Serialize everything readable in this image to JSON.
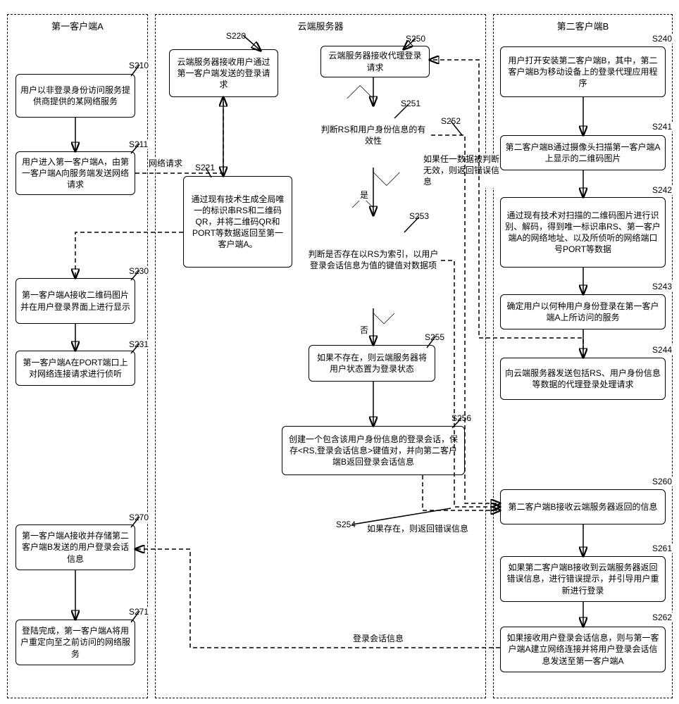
{
  "lanes": {
    "a_title": "第一客户端A",
    "s_title": "云端服务器",
    "b_title": "第二客户端B"
  },
  "steps": {
    "s210": "用户以非登录身份访问服务提供商提供的某网络服务",
    "s211": "用户进入第一客户端A，由第一客户端A向服务端发送网络请求",
    "s230": "第一客户端A接收二维码图片并在用户登录界面上进行显示",
    "s231": "第一客户端A在PORT端口上对网络连接请求进行侦听",
    "s270": "第一客户端A接收并存储第二客户端B发送的用户登录会话信息",
    "s271": "登陆完成，第一客户端A将用户重定向至之前访问的网络服务",
    "s220": "云端服务器接收用户通过第一客户端发送的登录请求",
    "s221": "通过现有技术生成全局唯一的标识串RS和二维码QR，并将二维码QR和PORT等数据返回至第一客户端A。",
    "s250": "云端服务器接收代理登录请求",
    "s251": "判断RS和用户身份信息的有效性",
    "s253": "判断是否存在以RS为索引，以用户登录会话信息为值的键值对数据项",
    "s255": "如果不存在，则云端服务器将用户状态置为登录状态",
    "s256": "创建一个包含该用户身份信息的登录会话，保存<RS,登录会话信息>键值对，并向第二客户端B返回登录会话信息",
    "s240": "用户打开安装第二客户端B，其中，第二客户端B为移动设备上的登录代理应用程序",
    "s241": "第二客户端B通过摄像头扫描第一客户端A上显示的二维码图片",
    "s242": "通过现有技术对扫描的二维码图片进行识别、解码，得到唯一标识串RS、第一客户端A的网络地址、以及所侦听的网络端口号PORT等数据",
    "s243": "确定用户以何种用户身份登录在第一客户端A上所访问的服务",
    "s244": "向云端服务器发送包括RS、用户身份信息等数据的代理登录处理请求",
    "s260": "第二客户端B接收云端服务器返回的信息",
    "s261": "如果第二客户端B接收到云端服务器返回错误信息，进行错误提示，并引导用户重新进行登录",
    "s262": "如果接收用户登录会话信息，则与第一客户端A建立网络连接并将用户登录会话信息发送至第一客户端A"
  },
  "tags": {
    "s210": "S210",
    "s211": "S211",
    "s220": "S220",
    "s221": "S221",
    "s230": "S230",
    "s231": "S231",
    "s240": "S240",
    "s241": "S241",
    "s242": "S242",
    "s243": "S243",
    "s244": "S244",
    "s250": "S250",
    "s251": "S251",
    "s252": "S252",
    "s253": "S253",
    "s254": "S254",
    "s255": "S255",
    "s256": "S256",
    "s260": "S260",
    "s261": "S261",
    "s262": "S262",
    "s270": "S270",
    "s271": "S271"
  },
  "edges": {
    "net_request": "网络请求",
    "yes": "是",
    "no": "否",
    "s252_note": "如果任一数据被判断无效，则返回错误信息",
    "s254_note": "如果存在，则返回错误信息",
    "login_session": "登录会话信息"
  }
}
